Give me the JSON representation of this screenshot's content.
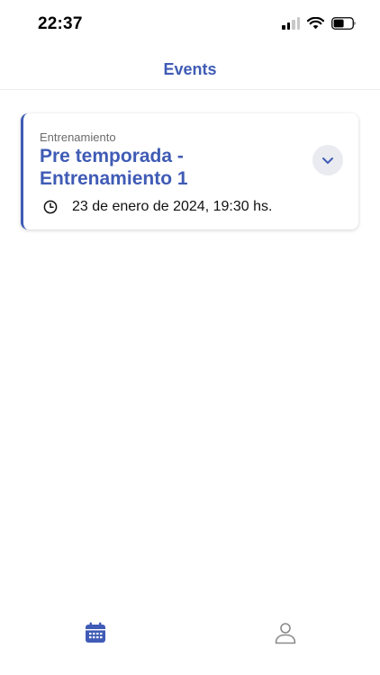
{
  "status_bar": {
    "time": "22:37",
    "icons": [
      "cellular-signal-icon",
      "wifi-icon",
      "battery-icon"
    ]
  },
  "header": {
    "title": "Events"
  },
  "events": [
    {
      "category": "Entrenamiento",
      "title": "Pre temporada - Entrenamiento 1",
      "datetime": "23 de enero de 2024, 19:30 hs.",
      "icon": "clock-icon",
      "expand_icon": "chevron-down-icon"
    }
  ],
  "tab_bar": {
    "tabs": [
      {
        "icon": "calendar-icon",
        "active": true
      },
      {
        "icon": "user-icon",
        "active": false
      }
    ]
  },
  "colors": {
    "accent": "#3f5bb5",
    "chevron_bg": "#e9ebf1",
    "inactive_icon": "#8a8a8a"
  }
}
